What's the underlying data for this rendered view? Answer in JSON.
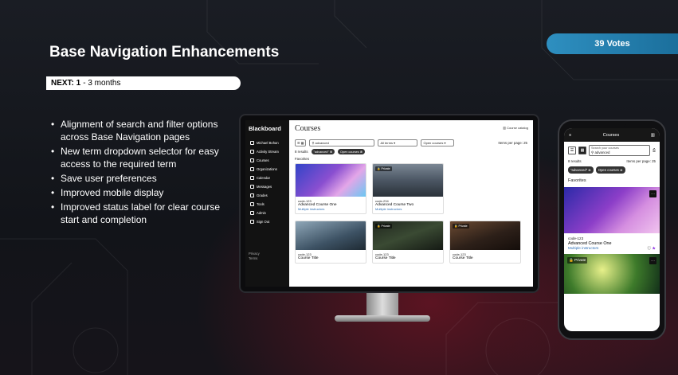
{
  "slide": {
    "title": "Base Navigation Enhancements",
    "votes": "39 Votes",
    "next_label": "NEXT: 1",
    "next_duration": "- 3 months",
    "bullets": [
      "Alignment of search and filter options across Base Navigation pages",
      "New term dropdown selector for easy access to the required term",
      "Save user preferences",
      "Improved mobile display",
      "Improved status label for clear course start and completion"
    ]
  },
  "desktop": {
    "brand": "Blackboard",
    "page_title": "Courses",
    "course_catalog": "Course catalog",
    "nav": [
      {
        "label": "Michael Bohan",
        "icon": "user-icon"
      },
      {
        "label": "Activity Stream",
        "icon": "activity-icon"
      },
      {
        "label": "Courses",
        "icon": "book-icon"
      },
      {
        "label": "Organizations",
        "icon": "org-icon"
      },
      {
        "label": "Calendar",
        "icon": "calendar-icon"
      },
      {
        "label": "Messages",
        "icon": "mail-icon"
      },
      {
        "label": "Grades",
        "icon": "grades-icon"
      },
      {
        "label": "Tools",
        "icon": "tools-icon"
      },
      {
        "label": "Admin",
        "icon": "admin-icon"
      },
      {
        "label": "Sign Out",
        "icon": "signout-icon"
      }
    ],
    "footer_privacy": "Privacy",
    "footer_terms": "Terms",
    "search_label": "Search your courses",
    "search_value": "advanced",
    "term_label": "Term",
    "term_value": "All terms",
    "filter_label": "Filter",
    "filter_value": "Open courses",
    "items_per_page": "Items per page: 25",
    "results": "8 results",
    "chips": [
      "\"advanced\"",
      "Open courses"
    ],
    "favorites_label": "Favorites",
    "favorite_cards": [
      {
        "code": "code-123",
        "title": "Advanced Course One",
        "instructors": "Multiple instructors",
        "private": ""
      },
      {
        "code": "code-234",
        "title": "Advanced Course Two",
        "instructors": "Multiple instructors",
        "private": "Private"
      }
    ],
    "course_cards": [
      {
        "code": "code-123",
        "title": "Course Title",
        "private": ""
      },
      {
        "code": "code-123",
        "title": "Course Title",
        "private": "Private"
      },
      {
        "code": "code-123",
        "title": "Course Title",
        "private": "Private"
      }
    ]
  },
  "mobile": {
    "title": "Courses",
    "search_label": "Search your courses",
    "search_value": "advanced",
    "results": "8 results",
    "items_per_page": "Items per page: 25",
    "chips": [
      "\"advanced\"",
      "Open courses"
    ],
    "favorites_label": "Favorites",
    "card": {
      "code": "code-123",
      "title": "Advanced Course One",
      "instructors": "Multiple instructors"
    },
    "private_label": "Private"
  },
  "colors": {
    "votes_bg": "#2e8fc0",
    "background": "#111318",
    "accent_red": "#96142a"
  }
}
